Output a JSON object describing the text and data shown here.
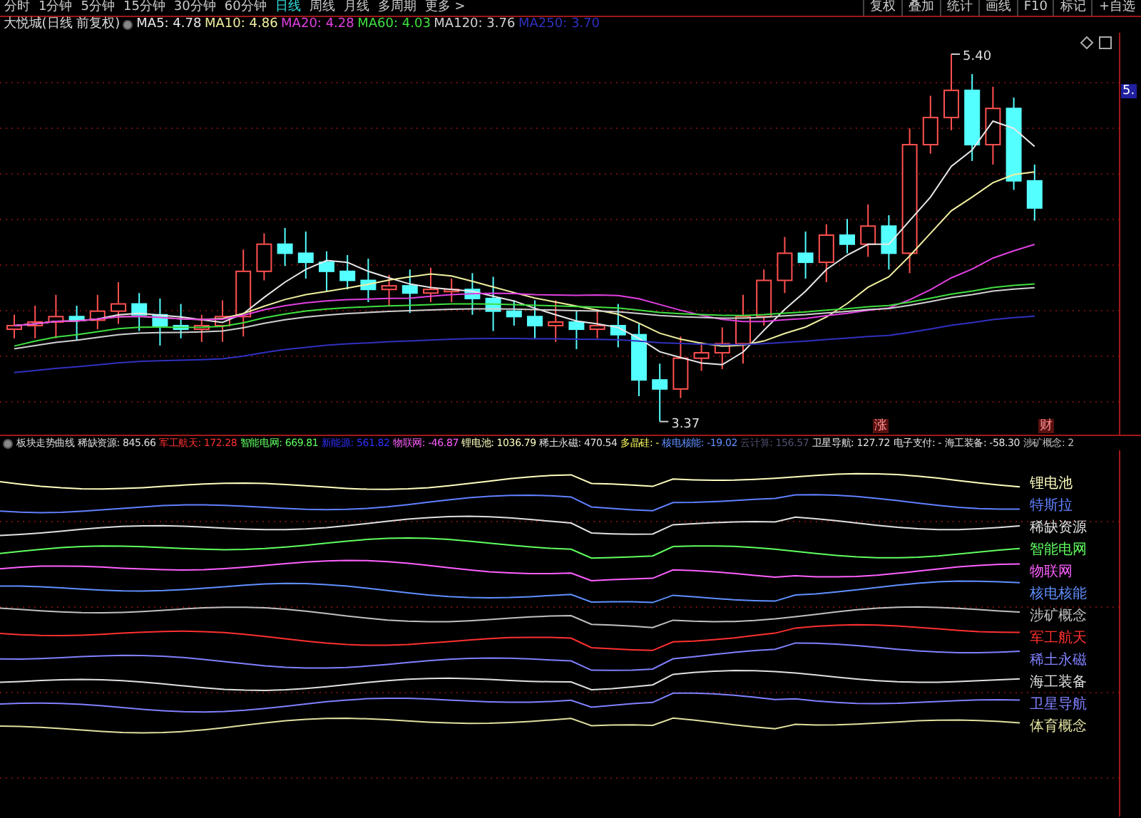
{
  "toolbar": {
    "periods": [
      {
        "label": "分时",
        "selected": false
      },
      {
        "label": "1分钟",
        "selected": false
      },
      {
        "label": "5分钟",
        "selected": false
      },
      {
        "label": "15分钟",
        "selected": false
      },
      {
        "label": "30分钟",
        "selected": false
      },
      {
        "label": "60分钟",
        "selected": false
      },
      {
        "label": "日线",
        "selected": true
      },
      {
        "label": "周线",
        "selected": false
      },
      {
        "label": "月线",
        "selected": false
      },
      {
        "label": "多周期",
        "selected": false
      },
      {
        "label": "更多 >",
        "selected": false
      }
    ],
    "actions": [
      "复权",
      "叠加",
      "统计",
      "画线",
      "F10",
      "标记",
      "+自选"
    ]
  },
  "price_pane": {
    "title": "大悦城(日线 前复权)",
    "moving_averages": [
      {
        "label": "MA5: 4.78",
        "color": "#e8e8e8"
      },
      {
        "label": "MA10: 4.86",
        "color": "#f0f0a0"
      },
      {
        "label": "MA20: 4.28",
        "color": "#e040e0"
      },
      {
        "label": "MA60: 4.03",
        "color": "#40e040"
      },
      {
        "label": "MA120: 3.76",
        "color": "#d0d0d0"
      },
      {
        "label": "MA250: 3.70",
        "color": "#3030c0"
      }
    ],
    "high_label": "5.40",
    "low_label": "3.37",
    "axis_label": "5.",
    "markers": [
      "涨",
      "财"
    ]
  },
  "indicator_pane": {
    "title": "板块走势曲线",
    "readings": [
      {
        "label": "稀缺资源: 845.66",
        "color": "#e0e0e0"
      },
      {
        "label": "军工航天: 172.28",
        "color": "#ff3030"
      },
      {
        "label": "智能电网: 669.81",
        "color": "#60ff60"
      },
      {
        "label": "新能源: 561.82",
        "color": "#3030ff"
      },
      {
        "label": "物联网: -46.87",
        "color": "#ff60ff"
      },
      {
        "label": "锂电池: 1036.79",
        "color": "#ffffc0"
      },
      {
        "label": "稀土永磁: 470.54",
        "color": "#e0e0e0"
      },
      {
        "label": "多晶硅: -",
        "color": "#ffff60"
      },
      {
        "label": "核电核能: -19.02",
        "color": "#6090ff"
      },
      {
        "label": "云计算: 156.57",
        "color": "#505070"
      },
      {
        "label": "卫星导航: 127.72",
        "color": "#e0e0e0"
      },
      {
        "label": "电子支付: -",
        "color": "#e0e0e0"
      },
      {
        "label": "海工装备: -58.30",
        "color": "#e0e0e0"
      },
      {
        "label": "涉矿概念: 2",
        "color": "#c0c0c0"
      }
    ],
    "curve_labels": [
      {
        "label": "锂电池",
        "color": "#ffffc0"
      },
      {
        "label": "特斯拉",
        "color": "#6080ff"
      },
      {
        "label": "稀缺资源",
        "color": "#e0e0e0"
      },
      {
        "label": "智能电网",
        "color": "#60ff60"
      },
      {
        "label": "物联网",
        "color": "#ff60ff"
      },
      {
        "label": "核电核能",
        "color": "#6090ff"
      },
      {
        "label": "涉矿概念",
        "color": "#c0c0c0"
      },
      {
        "label": "军工航天",
        "color": "#ff3030"
      },
      {
        "label": "稀土永磁",
        "color": "#8080ff"
      },
      {
        "label": "海工装备",
        "color": "#e0e0e0"
      },
      {
        "label": "卫星导航",
        "color": "#8080ff"
      },
      {
        "label": "体育概念",
        "color": "#e0e0a0"
      }
    ]
  }
}
